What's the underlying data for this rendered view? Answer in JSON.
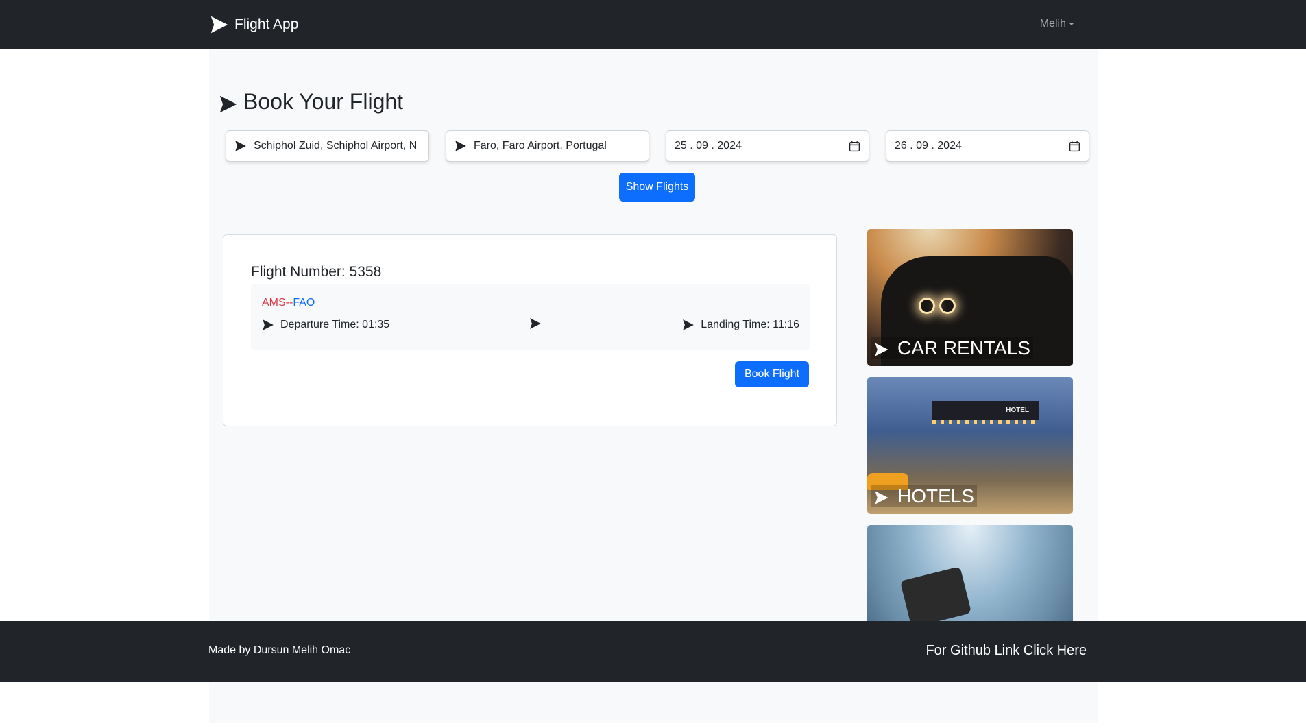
{
  "navbar": {
    "brand": "Flight App",
    "user": "Melih"
  },
  "main": {
    "title": "Book Your Flight",
    "search": {
      "from_value": "Schiphol Zuid, Schiphol Airport, N",
      "to_value": "Faro, Faro Airport, Portugal",
      "departure_date": "25 . 09 . 2024",
      "return_date": "26 . 09 . 2024",
      "show_button": "Show Flights"
    },
    "flight": {
      "number_label": "Flight Number: 5358",
      "origin": "AMS",
      "separator": "--",
      "destination": "FAO",
      "departure": "Departure Time: 01:35",
      "landing": "Landing Time: 11:16",
      "book_button": "Book Flight"
    },
    "tiles": {
      "car_rentals": "CAR RENTALS",
      "hotels": "HOTELS",
      "hotel_sign": "HOTEL"
    }
  },
  "footer": {
    "credit": "Made by Dursun Melih Omac",
    "github_link": "For Github Link Click Here"
  },
  "colors": {
    "navbar_bg": "#212529",
    "primary": "#0d6efd",
    "origin_code": "#dc3545",
    "destination_code": "#0d6efd",
    "page_bg": "#f8f9fa"
  },
  "icons": [
    "send-plane-icon",
    "calendar-icon",
    "caret-down-icon"
  ]
}
